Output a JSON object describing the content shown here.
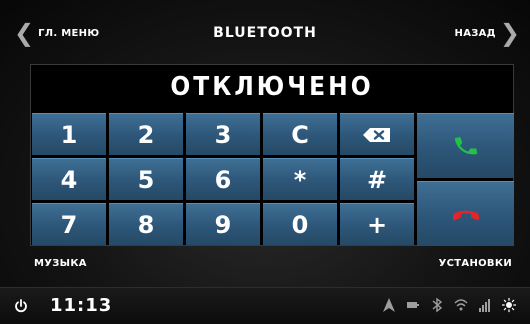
{
  "header": {
    "left_label": "ГЛ. МЕНЮ",
    "title": "BLUETOOTH",
    "right_label": "НАЗАД"
  },
  "display": {
    "status": "ОТКЛЮЧЕНО"
  },
  "keypad": {
    "keys": [
      "1",
      "2",
      "3",
      "С",
      "⌫",
      "4",
      "5",
      "6",
      "*",
      "#",
      "7",
      "8",
      "9",
      "0",
      "+"
    ],
    "call_icon": "phone-answer-icon",
    "hangup_icon": "phone-hangup-icon",
    "colors": {
      "key_blue": "#2d5678",
      "call_green": "#22c24a",
      "hangup_red": "#e0252b"
    }
  },
  "footer": {
    "left_label": "МУЗЫКА",
    "right_label": "УСТАНОВКИ"
  },
  "status_bar": {
    "time": "11:13",
    "icons": [
      "power-icon",
      "navigation-icon",
      "battery-icon",
      "bluetooth-icon",
      "wifi-icon",
      "signal-icon",
      "brightness-icon"
    ]
  }
}
